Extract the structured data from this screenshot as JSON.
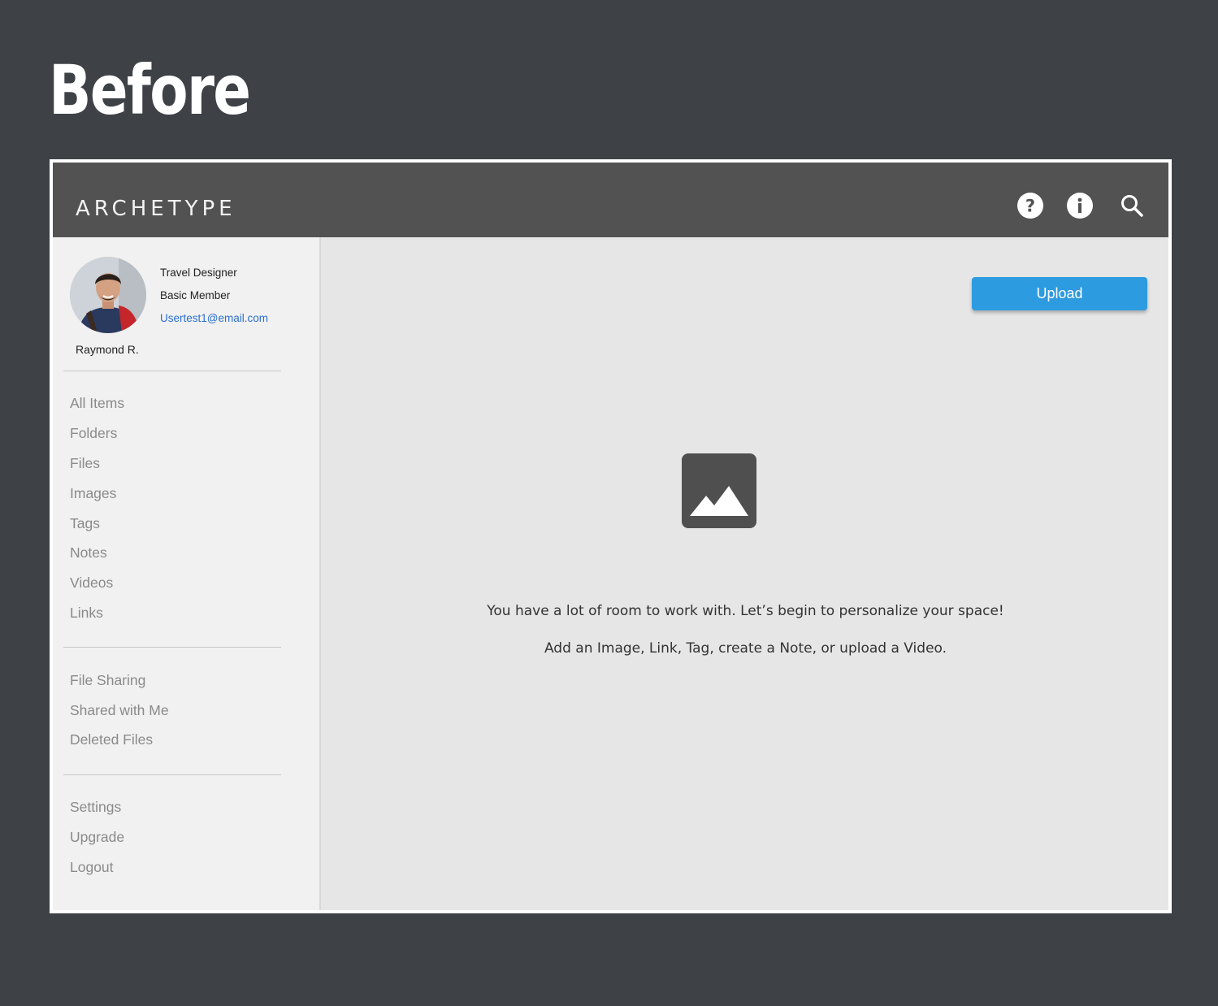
{
  "heading": "Before",
  "app": {
    "logo": "ARCHETYPE",
    "icons": [
      "help-icon",
      "info-icon",
      "search-icon"
    ]
  },
  "profile": {
    "title": "Travel Designer",
    "membership": "Basic Member",
    "email": "Usertest1@email.com",
    "name": "Raymond R."
  },
  "nav": {
    "group1": [
      "All Items",
      "Folders",
      "Files",
      "Images",
      "Tags",
      "Notes",
      "Videos",
      "Links"
    ],
    "group2": [
      "File Sharing",
      "Shared with Me",
      "Deleted Files"
    ],
    "group3": [
      "Settings",
      "Upgrade",
      "Logout"
    ]
  },
  "main": {
    "upload_label": "Upload",
    "empty_line1": "You have a lot of room to work with.  Let’s begin to personalize your space!",
    "empty_line2": "Add an Image, Link, Tag, create a Note, or upload a Video."
  },
  "colors": {
    "page_background": "#3e4146",
    "topbar": "#525252",
    "sidebar": "#f1f1f1",
    "main": "#e6e6e6",
    "accent": "#2d9be0",
    "link": "#2a6fcf"
  }
}
